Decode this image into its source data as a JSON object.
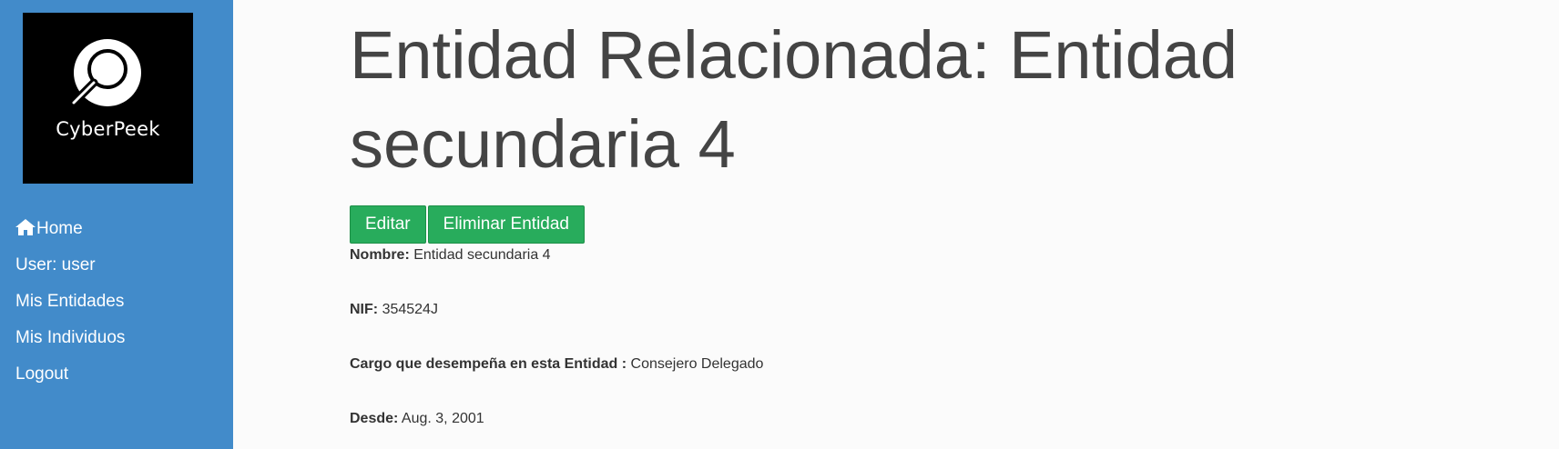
{
  "brand": {
    "name": "CyberPeek",
    "logo_icon": "magnifier-icon"
  },
  "nav": {
    "home": "Home",
    "user": "User: user",
    "entities": "Mis Entidades",
    "individuals": "Mis Individuos",
    "logout": "Logout"
  },
  "page": {
    "title": "Entidad Relacionada: Entidad secundaria 4"
  },
  "actions": {
    "edit": "Editar",
    "delete": "Eliminar Entidad"
  },
  "details": {
    "name_label": "Nombre:",
    "name_value": "Entidad secundaria 4",
    "nif_label": "NIF:",
    "nif_value": "354524J",
    "role_label": "Cargo que desempeña en esta Entidad :",
    "role_value": "Consejero Delegado",
    "since_label": "Desde:",
    "since_value": "Aug. 3, 2001"
  },
  "colors": {
    "sidebar": "#428bca",
    "button": "#28ac5c",
    "background": "#fbfbfb"
  }
}
